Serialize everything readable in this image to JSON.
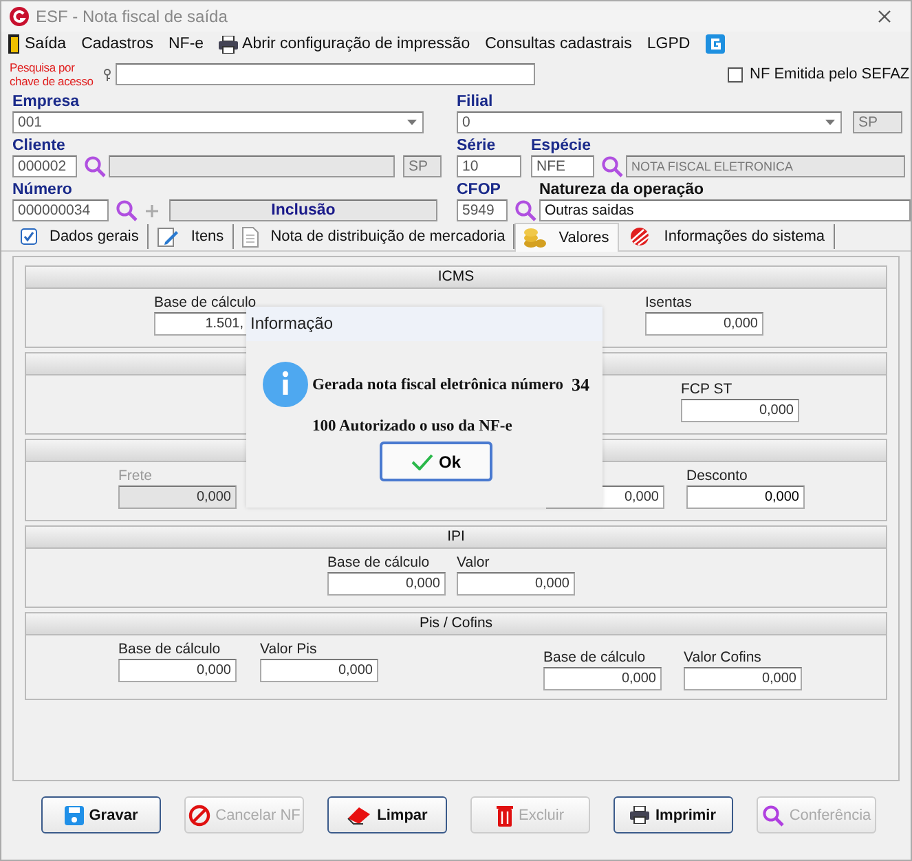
{
  "window": {
    "title": "ESF - Nota fiscal de saída"
  },
  "menu": [
    "Saída",
    "Cadastros",
    "NF-e",
    "Abrir configuração de impressão",
    "Consultas cadastrais",
    "LGPD"
  ],
  "search": {
    "label": "Pesquisa por chave de acesso"
  },
  "nf_emitida_sefaz": {
    "label": "NF Emitida pelo SEFAZ",
    "checked": false
  },
  "empresa": {
    "label": "Empresa",
    "value": "001"
  },
  "filial": {
    "label": "Filial",
    "value": "0",
    "uf": "SP"
  },
  "cliente": {
    "label": "Cliente",
    "code": "000002",
    "uf": "SP"
  },
  "serie": {
    "label": "Série",
    "value": "10"
  },
  "especie": {
    "label": "Espécie",
    "code": "NFE",
    "name": "NOTA FISCAL ELETRONICA"
  },
  "numero": {
    "label": "Número",
    "value": "000000034",
    "status": "Inclusão"
  },
  "cfop": {
    "label": "CFOP",
    "value": "5949"
  },
  "natureza": {
    "label": "Natureza da operação",
    "value": "Outras saidas"
  },
  "tabs": [
    {
      "label": "Dados gerais",
      "selected": false
    },
    {
      "label": "Itens",
      "selected": false
    },
    {
      "label": "Nota de distribuição de mercadoria",
      "selected": false
    },
    {
      "label": "Valores",
      "selected": true
    },
    {
      "label": "Informações do sistema",
      "selected": false
    }
  ],
  "sections": [
    {
      "title": "ICMS",
      "fields": [
        {
          "label": "Base de cálculo",
          "value": "1.501,",
          "disabled": false
        },
        {
          "label": "Isentas",
          "value": "0,000",
          "disabled": false
        }
      ]
    },
    {
      "fields": [
        {
          "label": "FCP ST",
          "value": "0,000",
          "disabled": false
        }
      ]
    },
    {
      "fields": [
        {
          "label": "Frete",
          "value": "0,000",
          "disabled": true
        },
        {
          "value": "0,000",
          "disabled": false
        },
        {
          "label": "Desconto",
          "value": "0,000",
          "disabled": false
        }
      ]
    },
    {
      "title": "IPI",
      "fields": [
        {
          "label": "Base de cálculo",
          "value": "0,000",
          "disabled": false
        },
        {
          "label": "Valor",
          "value": "0,000",
          "disabled": false
        }
      ]
    },
    {
      "title": "Pis / Cofins",
      "fields": [
        {
          "label": "Base de cálculo",
          "value": "0,000",
          "disabled": false
        },
        {
          "label": "Valor Pis",
          "value": "0,000",
          "disabled": false
        },
        {
          "label": "Base de cálculo",
          "value": "0,000",
          "disabled": false
        },
        {
          "label": "Valor Cofins",
          "value": "0,000",
          "disabled": false
        }
      ]
    }
  ],
  "buttons": [
    {
      "label": "Gravar",
      "disabled": false
    },
    {
      "label": "Cancelar NF",
      "disabled": true
    },
    {
      "label": "Limpar",
      "disabled": false
    },
    {
      "label": "Excluir",
      "disabled": true
    },
    {
      "label": "Imprimir",
      "disabled": false
    },
    {
      "label": "Conferência",
      "disabled": true
    }
  ],
  "dialog": {
    "title": "Informação",
    "message": "Gerada nota fiscal eletrônica número",
    "number": "34",
    "status": "100 Autorizado o uso da NF-e",
    "button": "Ok"
  }
}
